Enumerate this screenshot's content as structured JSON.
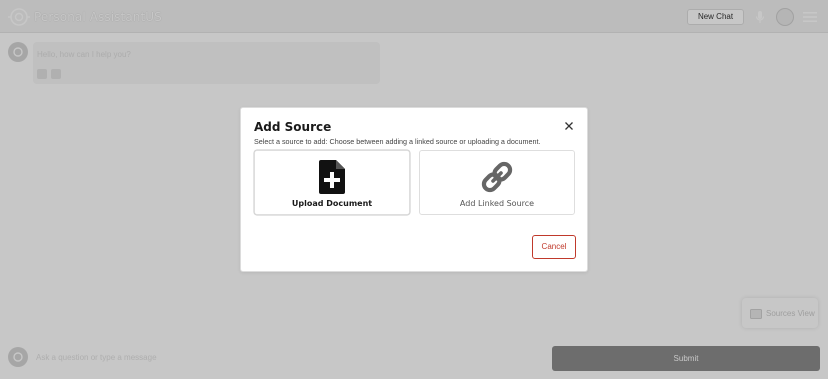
{
  "header": {
    "app_title": "Personal AssistantUS",
    "new_chat_label": "New Chat",
    "icons": [
      "mic-icon",
      "avatar",
      "menu-icon"
    ]
  },
  "chat": {
    "message_text": "Hello, how can I help you?"
  },
  "sources_widget": {
    "label": "Sources View"
  },
  "composer": {
    "placeholder": "Ask a question or type a message",
    "submit_label": "Submit"
  },
  "modal": {
    "title": "Add Source",
    "subtitle": "Select a source to add: Choose between adding a linked source or uploading a document.",
    "options": [
      {
        "label": "Upload Document",
        "icon": "file-plus-icon"
      },
      {
        "label": "Add Linked Source",
        "icon": "link-icon"
      }
    ],
    "cancel_label": "Cancel"
  },
  "colors": {
    "cancel_accent": "#c0392b",
    "submit_bg": "#8c8c8c",
    "overlay": "rgba(0,0,0,0.22)"
  }
}
